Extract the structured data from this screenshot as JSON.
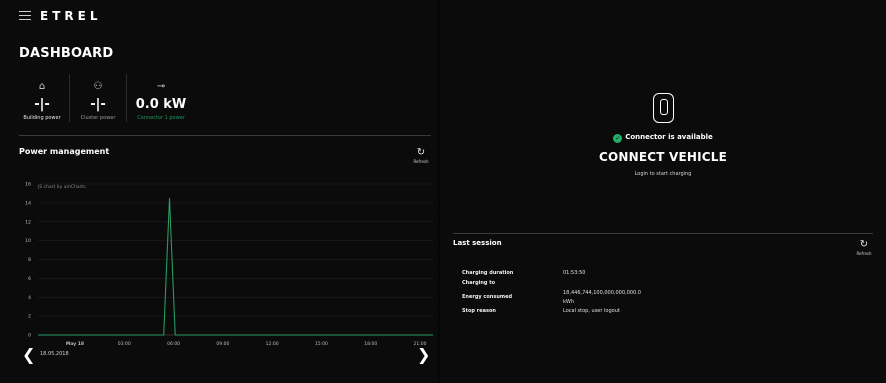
{
  "header": {
    "brand": "ETRΕL"
  },
  "dashboard": {
    "title": "DASHBOARD",
    "metrics": [
      {
        "icon": "home-icon",
        "value": "-|-",
        "label": "Building power"
      },
      {
        "icon": "cluster-icon",
        "value": "-|-",
        "label": "Cluster power"
      },
      {
        "icon": "plug-icon",
        "value": "0.0 kW",
        "label": "Connector 1 power"
      }
    ]
  },
  "power_management": {
    "title": "Power management",
    "refresh_label": "Refresh",
    "watermark": "JS chart by amCharts",
    "date": "18.05.2018",
    "colors": {
      "line": "#2a9a63",
      "grid": "#242424",
      "axis_text": "#bdbdbd"
    }
  },
  "chart_data": {
    "type": "line",
    "x_tick_labels": [
      "May 18",
      "03:00",
      "06:00",
      "09:00",
      "12:00",
      "15:00",
      "18:00",
      "21:00"
    ],
    "y_tick_labels": [
      "0",
      "2",
      "4",
      "6",
      "8",
      "10",
      "12",
      "14",
      "16"
    ],
    "ylim": [
      0,
      16
    ],
    "xlim_hours": [
      0,
      21
    ],
    "grid": true,
    "series": [
      {
        "x_hours": [
          0,
          5.4,
          5.75,
          6.1,
          21
        ],
        "y": [
          0,
          0,
          14.5,
          0,
          0
        ]
      }
    ]
  },
  "connector": {
    "status": "Connector is available",
    "headline": "CONNECT VEHICLE",
    "hint": "Login to start charging"
  },
  "last_session": {
    "title": "Last session",
    "refresh_label": "Refresh",
    "rows": [
      {
        "key": "Charging duration",
        "value": "01:53:50"
      },
      {
        "key": "Charging to",
        "value": ""
      },
      {
        "key": "Energy consumed",
        "value": "18,446,744,100,000,000,000.0"
      },
      {
        "key": "",
        "value": "kWh"
      },
      {
        "key": "Stop reason",
        "value": "Local stop, user logout"
      }
    ]
  }
}
